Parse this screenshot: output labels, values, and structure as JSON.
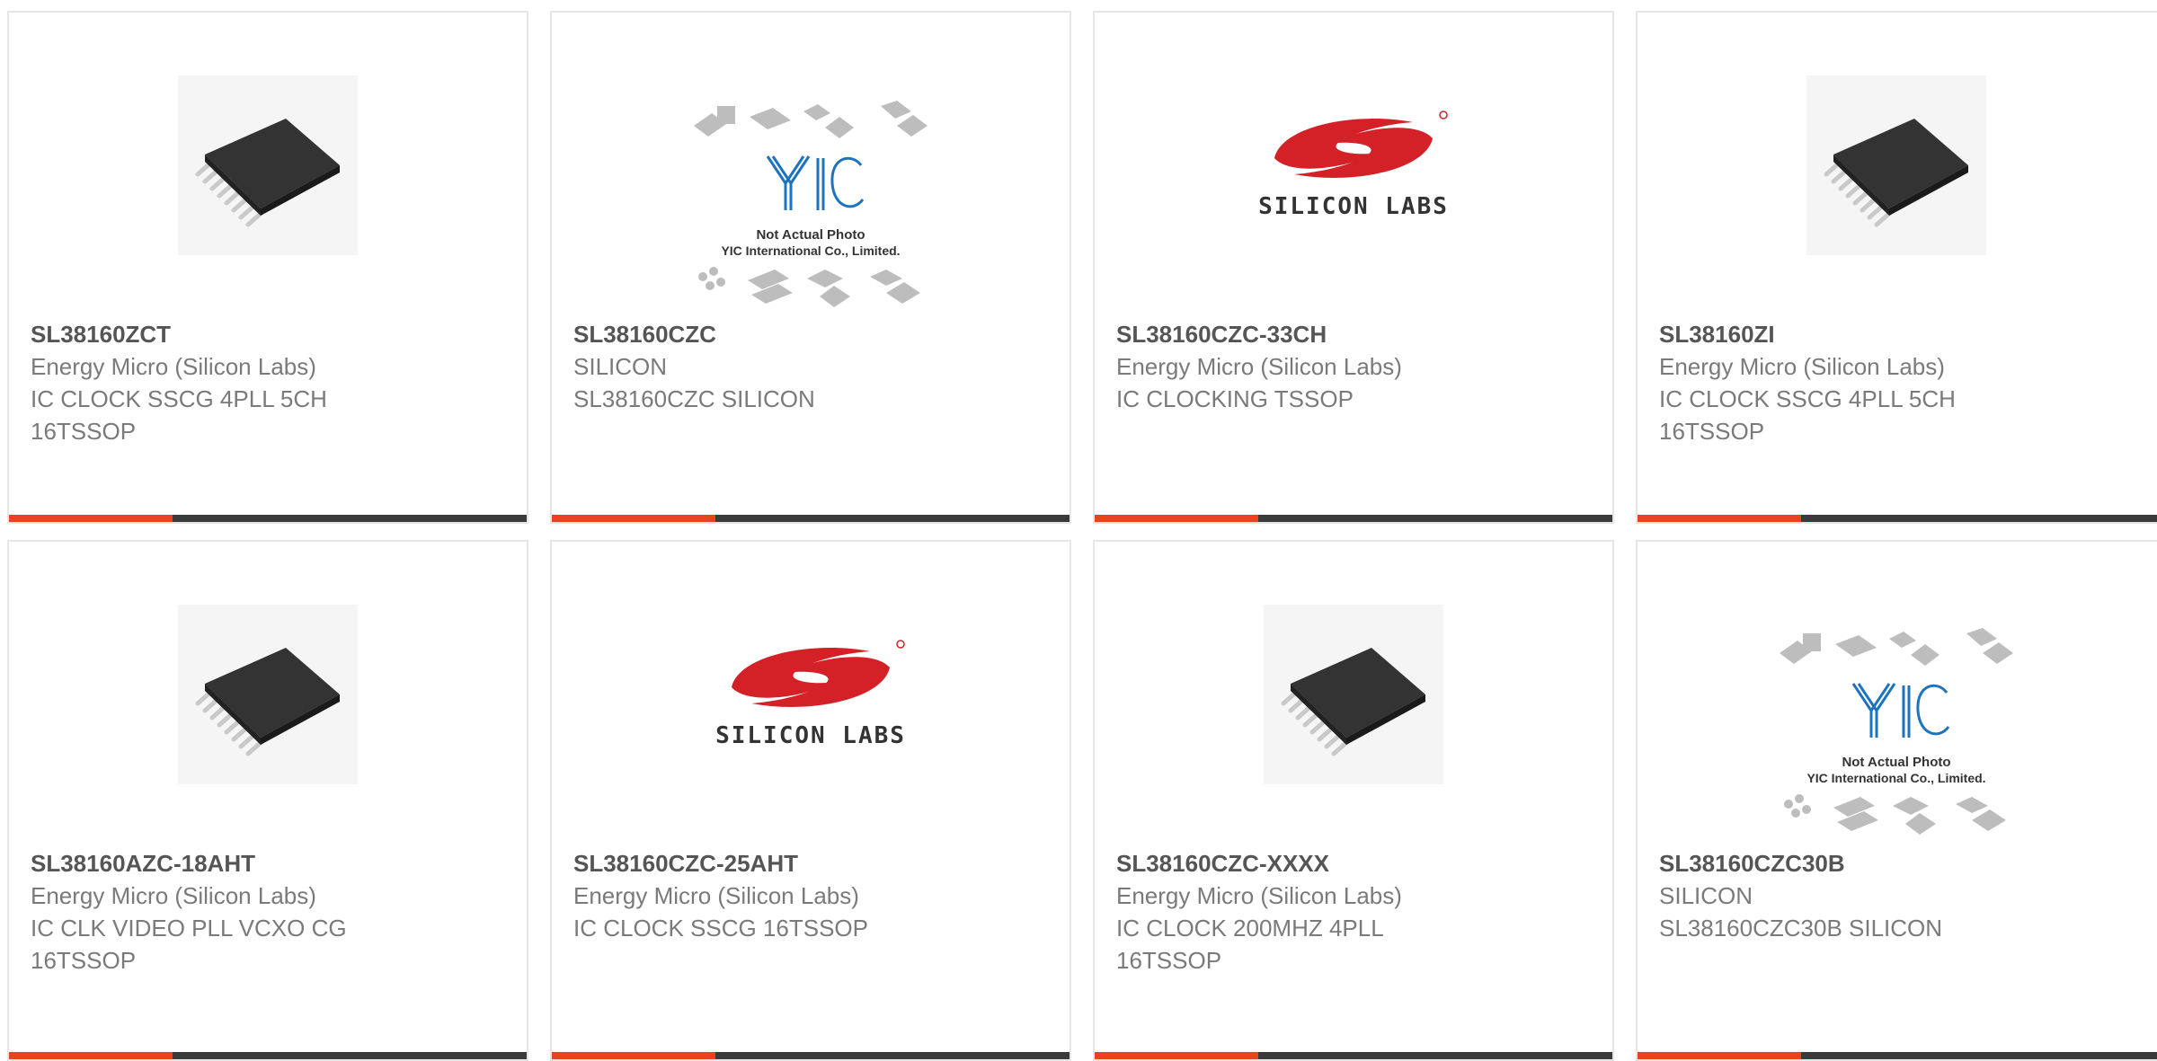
{
  "colors": {
    "accent": "#e8431e",
    "bar": "#3a3a3a",
    "part_number": "#555555",
    "text": "#7a7a7a",
    "border": "#e6e6e6",
    "silicon_labs_red": "#d42128"
  },
  "products": [
    {
      "part_number": "SL38160ZCT",
      "manufacturer": "Energy Micro (Silicon Labs)",
      "description": "IC CLOCK SSCG 4PLL 5CH 16TSSOP",
      "image": "chip-tssop-photo"
    },
    {
      "part_number": "SL38160CZC",
      "manufacturer": "SILICON",
      "description": "SL38160CZC SILICON",
      "image": "yic-not-actual-photo",
      "image_caption_line1": "Not Actual Photo",
      "image_caption_line2": "YIC International Co., Limited."
    },
    {
      "part_number": "SL38160CZC-33CH",
      "manufacturer": "Energy Micro (Silicon Labs)",
      "description": "IC CLOCKING TSSOP",
      "image": "silicon-labs-logo",
      "logo_text": "SILICON LABS"
    },
    {
      "part_number": "SL38160ZI",
      "manufacturer": "Energy Micro (Silicon Labs)",
      "description": "IC CLOCK SSCG 4PLL 5CH 16TSSOP",
      "image": "chip-tssop-photo"
    },
    {
      "part_number": "SL38160AZC-18AHT",
      "manufacturer": "Energy Micro (Silicon Labs)",
      "description": "IC CLK VIDEO PLL VCXO CG 16TSSOP",
      "image": "chip-tssop-photo"
    },
    {
      "part_number": "SL38160CZC-25AHT",
      "manufacturer": "Energy Micro (Silicon Labs)",
      "description": "IC CLOCK SSCG 16TSSOP",
      "image": "silicon-labs-logo",
      "logo_text": "SILICON LABS"
    },
    {
      "part_number": "SL38160CZC-XXXX",
      "manufacturer": "Energy Micro (Silicon Labs)",
      "description": "IC CLOCK 200MHZ 4PLL 16TSSOP",
      "image": "chip-tssop-photo"
    },
    {
      "part_number": "SL38160CZC30B",
      "manufacturer": "SILICON",
      "description": "SL38160CZC30B SILICON",
      "image": "yic-not-actual-photo",
      "image_caption_line1": "Not Actual Photo",
      "image_caption_line2": "YIC International Co., Limited."
    }
  ]
}
